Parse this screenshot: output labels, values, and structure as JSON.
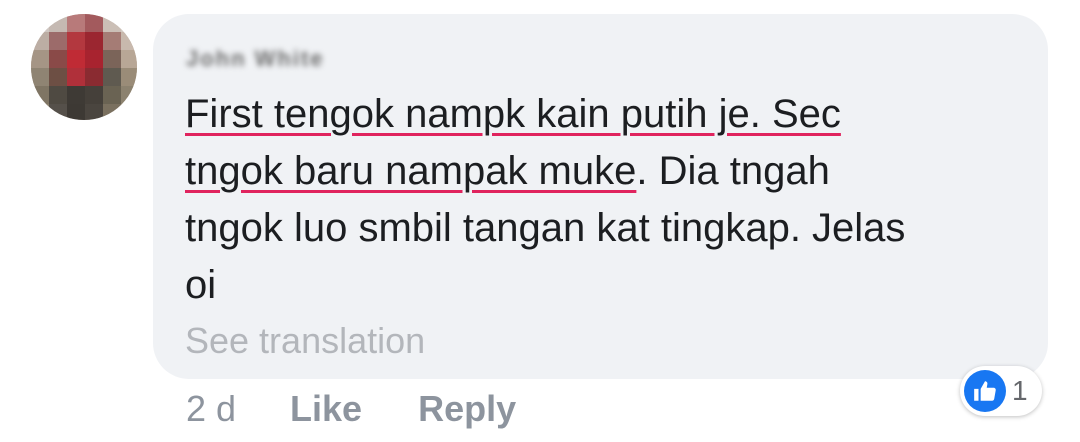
{
  "comment": {
    "author": "John White",
    "text_lines": [
      [
        "First tengok nampk kain putih je. Sec",
        ""
      ],
      [
        "tngok baru nampak muke",
        ". Dia tngah"
      ],
      [
        "tngok luo smbil tangan kat tingkap. Jelas",
        ""
      ],
      [
        "oi",
        ""
      ]
    ],
    "see_translation": "See translation"
  },
  "footer": {
    "time": "2 d",
    "like_label": "Like",
    "reply_label": "Reply"
  },
  "reactions": {
    "icon": "thumbs-up-icon",
    "count": "1",
    "color": "#1877f2"
  },
  "avatar": {
    "icon": "user-avatar-pixelated"
  }
}
